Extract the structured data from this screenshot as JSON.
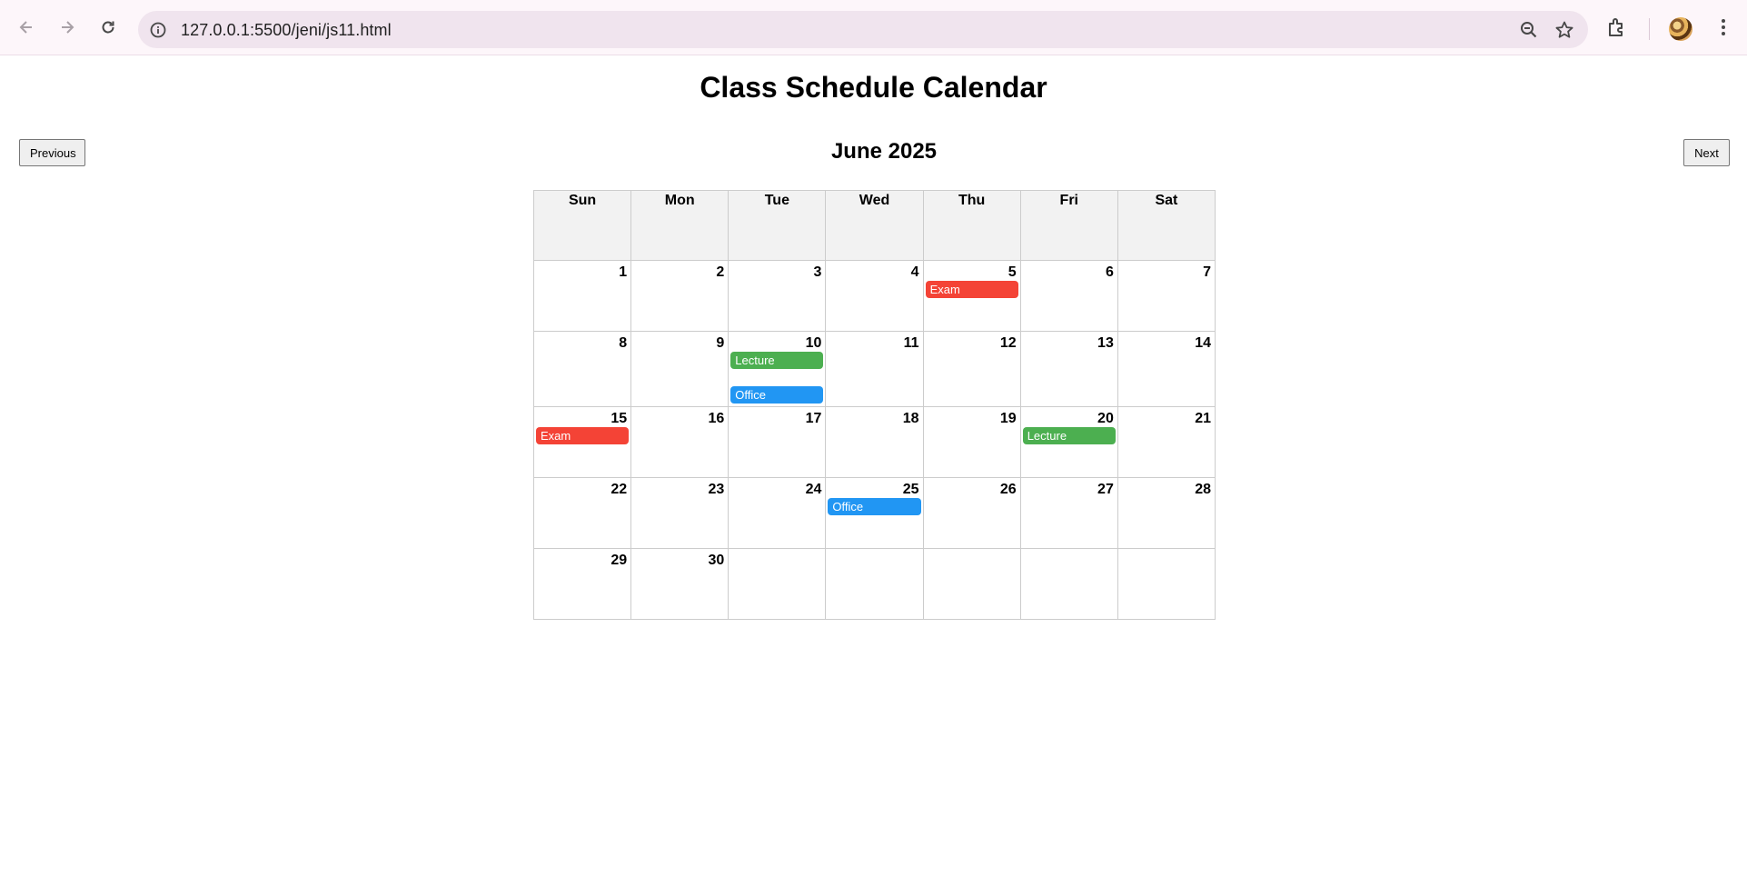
{
  "browser": {
    "url": "127.0.0.1:5500/jeni/js11.html"
  },
  "page": {
    "title": "Class Schedule Calendar",
    "prev_label": "Previous",
    "next_label": "Next",
    "month_label": "June 2025"
  },
  "calendar": {
    "weekdays": [
      "Sun",
      "Mon",
      "Tue",
      "Wed",
      "Thu",
      "Fri",
      "Sat"
    ],
    "weeks": [
      [
        {
          "day": "1",
          "events": []
        },
        {
          "day": "2",
          "events": []
        },
        {
          "day": "3",
          "events": []
        },
        {
          "day": "4",
          "events": []
        },
        {
          "day": "5",
          "events": [
            {
              "label": "Exam",
              "type": "exam"
            }
          ]
        },
        {
          "day": "6",
          "events": []
        },
        {
          "day": "7",
          "events": []
        }
      ],
      [
        {
          "day": "8",
          "events": []
        },
        {
          "day": "9",
          "events": []
        },
        {
          "day": "10",
          "events": [
            {
              "label": "Lecture",
              "type": "lecture"
            },
            {
              "label": "Office",
              "type": "office"
            }
          ]
        },
        {
          "day": "11",
          "events": []
        },
        {
          "day": "12",
          "events": []
        },
        {
          "day": "13",
          "events": []
        },
        {
          "day": "14",
          "events": []
        }
      ],
      [
        {
          "day": "15",
          "events": [
            {
              "label": "Exam",
              "type": "exam"
            }
          ]
        },
        {
          "day": "16",
          "events": []
        },
        {
          "day": "17",
          "events": []
        },
        {
          "day": "18",
          "events": []
        },
        {
          "day": "19",
          "events": []
        },
        {
          "day": "20",
          "events": [
            {
              "label": "Lecture",
              "type": "lecture"
            }
          ]
        },
        {
          "day": "21",
          "events": []
        }
      ],
      [
        {
          "day": "22",
          "events": []
        },
        {
          "day": "23",
          "events": []
        },
        {
          "day": "24",
          "events": []
        },
        {
          "day": "25",
          "events": [
            {
              "label": "Office",
              "type": "office"
            }
          ]
        },
        {
          "day": "26",
          "events": []
        },
        {
          "day": "27",
          "events": []
        },
        {
          "day": "28",
          "events": []
        }
      ],
      [
        {
          "day": "29",
          "events": []
        },
        {
          "day": "30",
          "events": []
        },
        {
          "day": "",
          "events": []
        },
        {
          "day": "",
          "events": []
        },
        {
          "day": "",
          "events": []
        },
        {
          "day": "",
          "events": []
        },
        {
          "day": "",
          "events": []
        }
      ]
    ]
  },
  "colors": {
    "exam": "#f44336",
    "lecture": "#4caf50",
    "office": "#2196f3"
  },
  "icons": [
    "back-arrow-icon",
    "forward-arrow-icon",
    "reload-icon",
    "site-info-icon",
    "zoom-out-icon",
    "bookmark-star-icon",
    "extensions-icon",
    "profile-avatar",
    "kebab-menu-icon"
  ]
}
